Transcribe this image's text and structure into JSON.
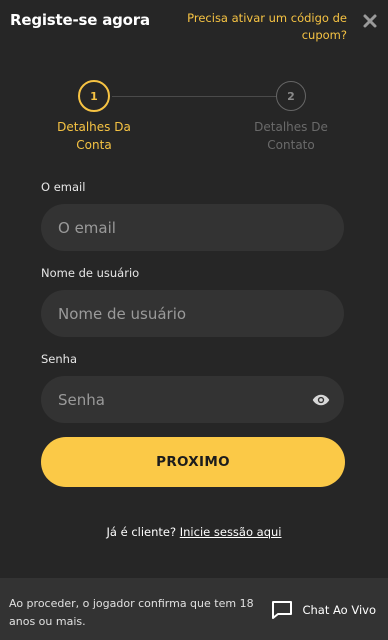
{
  "header": {
    "title": "Registe-se agora",
    "coupon_link": "Precisa ativar um código de cupom?"
  },
  "stepper": {
    "steps": [
      {
        "number": "1",
        "label": "Detalhes Da Conta",
        "active": true
      },
      {
        "number": "2",
        "label": "Detalhes De Contato",
        "active": false
      }
    ]
  },
  "form": {
    "email": {
      "label": "O email",
      "placeholder": "O email",
      "value": ""
    },
    "username": {
      "label": "Nome de usuário",
      "placeholder": "Nome de usuário",
      "value": ""
    },
    "password": {
      "label": "Senha",
      "placeholder": "Senha",
      "value": ""
    },
    "submit_label": "PROXIMO"
  },
  "login": {
    "prompt": "Já é cliente?",
    "link": "Inicie sessão aqui"
  },
  "footer": {
    "disclaimer": "Ao proceder, o jogador confirma que tem 18 anos ou mais.",
    "chat_label": "Chat Ao Vivo"
  },
  "colors": {
    "background": "#262626",
    "input_background": "#333333",
    "accent": "#fbc947",
    "accent_text": "#f6c343"
  },
  "icons": {
    "close": "close-icon",
    "password_toggle": "eye-icon",
    "chat": "chat-bubble-icon"
  }
}
